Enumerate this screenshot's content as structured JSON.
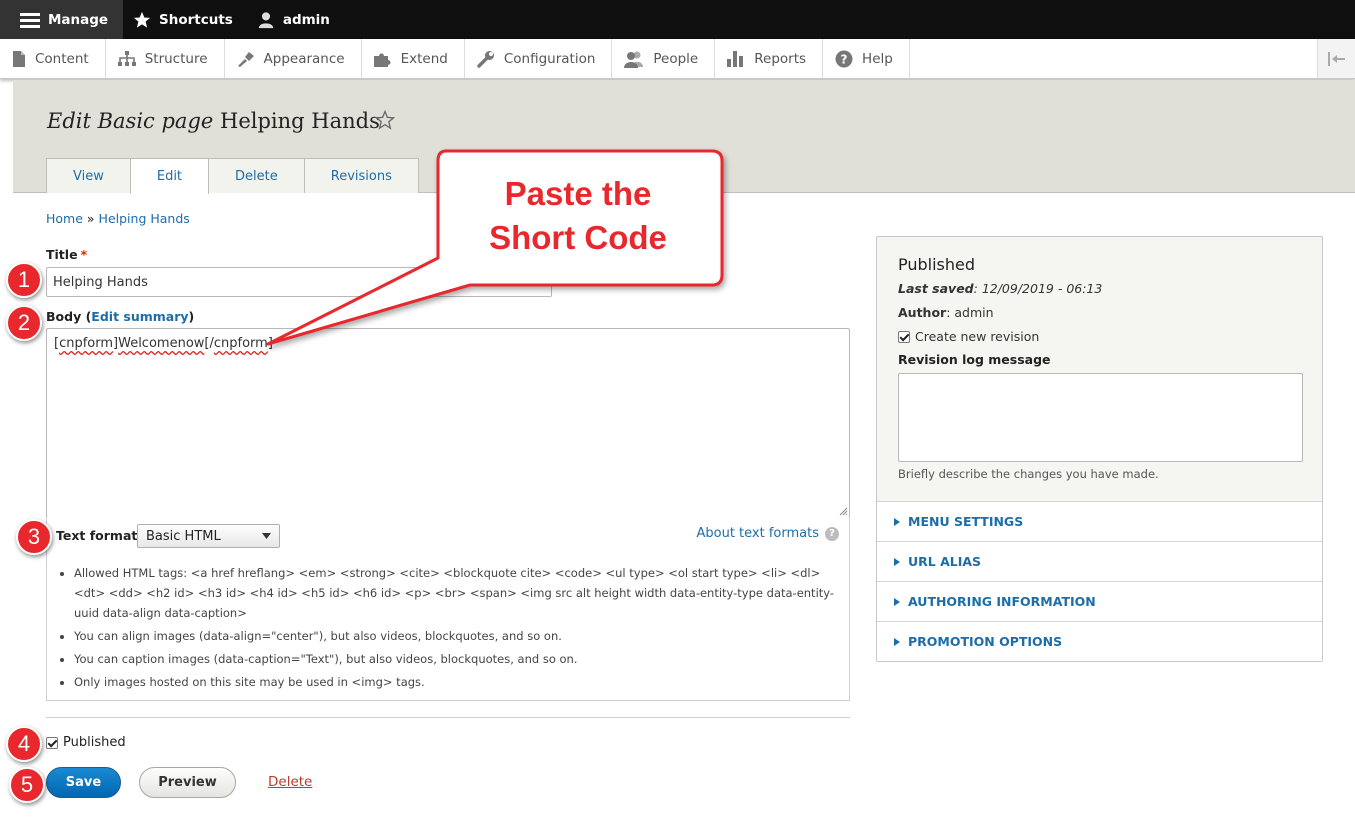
{
  "toolbar": {
    "manage": "Manage",
    "shortcuts": "Shortcuts",
    "user": "admin"
  },
  "tray": {
    "items": [
      "Content",
      "Structure",
      "Appearance",
      "Extend",
      "Configuration",
      "People",
      "Reports",
      "Help"
    ]
  },
  "header": {
    "title_prefix": "Edit Basic page",
    "title_name": "Helping Hands",
    "tabs": [
      "View",
      "Edit",
      "Delete",
      "Revisions"
    ],
    "active_tab": "Edit"
  },
  "breadcrumb": {
    "home": "Home",
    "sep": "»",
    "current": "Helping Hands"
  },
  "form": {
    "title_label": "Title",
    "required_mark": "*",
    "title_value": "Helping Hands",
    "body_label": "Body",
    "edit_summary": "Edit summary",
    "body_value_parts": [
      "[",
      "cnpform",
      "]",
      "Welcomenow",
      "[/",
      "cnpform",
      "]"
    ],
    "text_format_label": "Text format",
    "text_format_value": "Basic HTML",
    "about_text_formats": "About text formats",
    "tips": [
      "Allowed HTML tags: <a href hreflang> <em> <strong> <cite> <blockquote cite> <code> <ul type> <ol start type> <li> <dl> <dt> <dd> <h2 id> <h3 id> <h4 id> <h5 id> <h6 id> <p> <br> <span> <img src alt height width data-entity-type data-entity-uuid data-align data-caption>",
      "You can align images (data-align=\"center\"), but also videos, blockquotes, and so on.",
      "You can caption images (data-caption=\"Text\"), but also videos, blockquotes, and so on.",
      "Only images hosted on this site may be used in <img> tags."
    ],
    "published_label": "Published",
    "published_checked": true,
    "save": "Save",
    "preview": "Preview",
    "delete": "Delete"
  },
  "sidebar": {
    "status": "Published",
    "last_saved_label": "Last saved",
    "last_saved_value": "12/09/2019 - 06:13",
    "author_label": "Author",
    "author_value": "admin",
    "create_revision": "Create new revision",
    "revision_log_label": "Revision log message",
    "revision_log_desc": "Briefly describe the changes you have made.",
    "sections": [
      "MENU SETTINGS",
      "URL ALIAS",
      "AUTHORING INFORMATION",
      "PROMOTION OPTIONS"
    ]
  },
  "annotations": {
    "steps": [
      "1",
      "2",
      "3",
      "4",
      "5"
    ],
    "callout_line1": "Paste the",
    "callout_line2": "Short Code",
    "accent_color": "#e8282c"
  }
}
